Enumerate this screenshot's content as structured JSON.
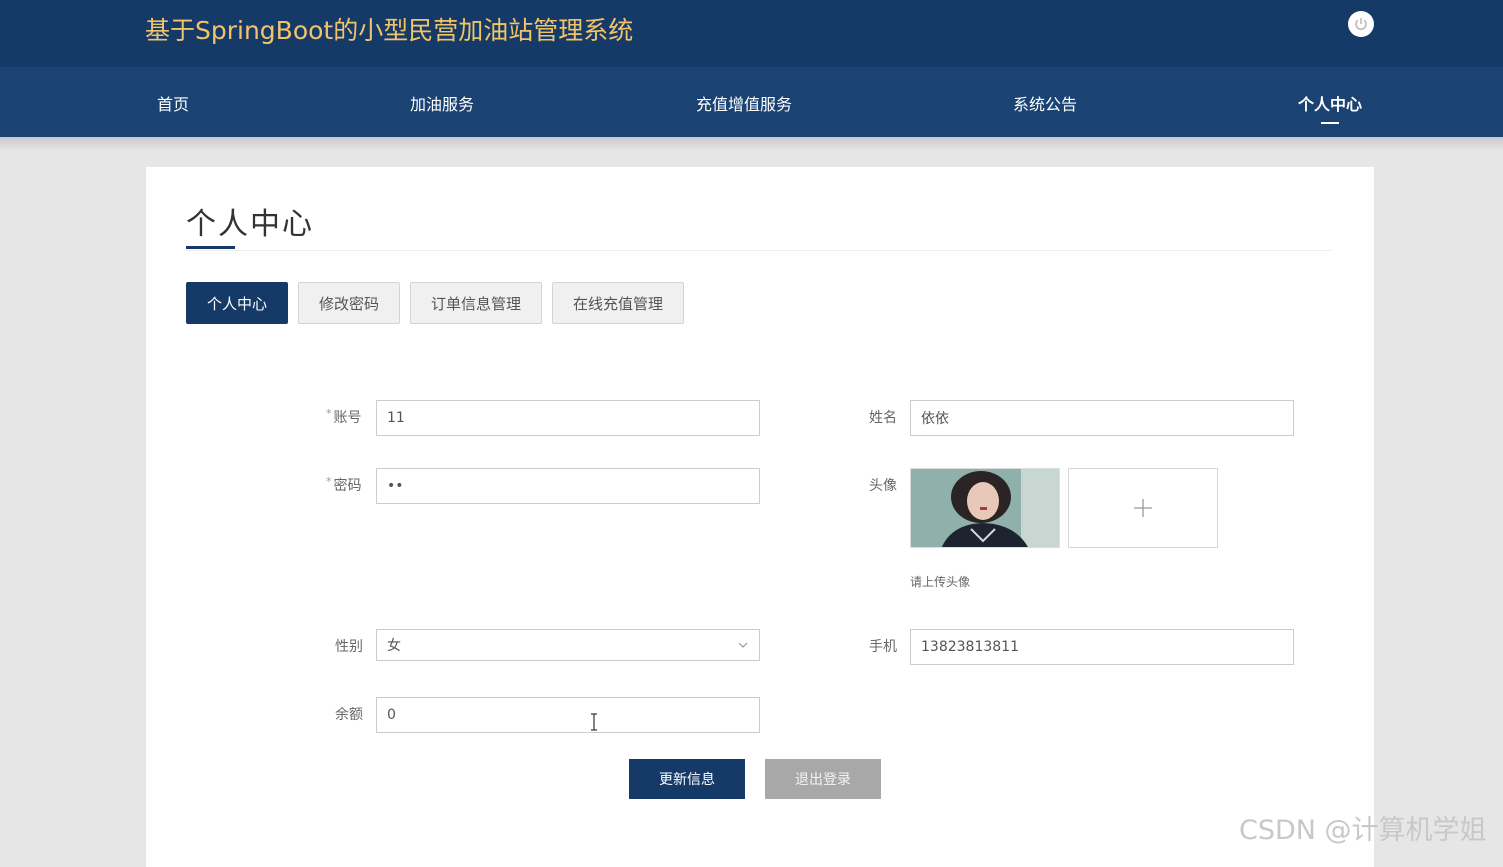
{
  "header": {
    "app_title": "基于SpringBoot的小型民营加油站管理系统",
    "power_icon": "power-icon"
  },
  "nav": {
    "items": [
      {
        "label": "首页"
      },
      {
        "label": "加油服务"
      },
      {
        "label": "充值增值服务"
      },
      {
        "label": "系统公告"
      },
      {
        "label": "个人中心",
        "active": true
      }
    ]
  },
  "page": {
    "title": "个人中心"
  },
  "tabs": [
    {
      "label": "个人中心",
      "active": true
    },
    {
      "label": "修改密码"
    },
    {
      "label": "订单信息管理"
    },
    {
      "label": "在线充值管理"
    }
  ],
  "form": {
    "account": {
      "label": "账号",
      "required_mark": "*",
      "value": "11"
    },
    "password": {
      "label": "密码",
      "required_mark": "*",
      "value": "••"
    },
    "gender": {
      "label": "性别",
      "value": "女"
    },
    "balance": {
      "label": "余额",
      "value": "0"
    },
    "name": {
      "label": "姓名",
      "value": "依依"
    },
    "avatar": {
      "label": "头像",
      "upload_tip": "请上传头像",
      "upload_icon": "plus-icon"
    },
    "phone": {
      "label": "手机",
      "value": "13823813811"
    }
  },
  "actions": {
    "update_label": "更新信息",
    "logout_label": "退出登录"
  },
  "watermark": "CSDN @计算机学姐",
  "colors": {
    "primary": "#163a68",
    "title_accent": "#f0c46a",
    "secondary_button": "#a8a8a8"
  }
}
